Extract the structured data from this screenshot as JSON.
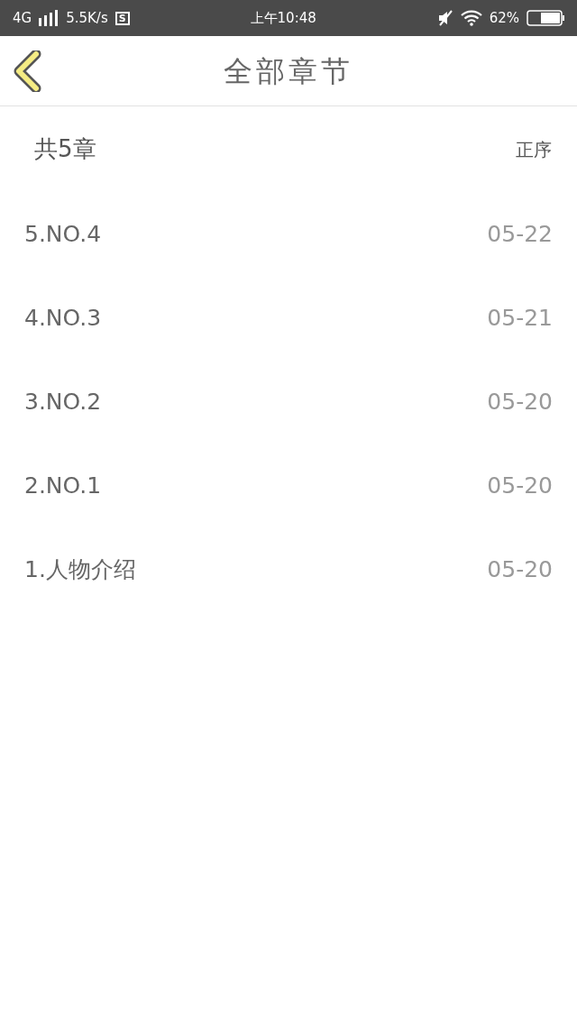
{
  "status_bar": {
    "network": "4G",
    "speed": "5.5K/s",
    "notification_badge": "S",
    "time": "上午10:48",
    "battery": "62%"
  },
  "header": {
    "title": "全部章节"
  },
  "summary": {
    "count": "共5章",
    "sort": "正序"
  },
  "chapters": [
    {
      "title": "5.NO.4",
      "date": "05-22"
    },
    {
      "title": "4.NO.3",
      "date": "05-21"
    },
    {
      "title": "3.NO.2",
      "date": "05-20"
    },
    {
      "title": "2.NO.1",
      "date": "05-20"
    },
    {
      "title": "1.人物介绍",
      "date": "05-20"
    }
  ]
}
